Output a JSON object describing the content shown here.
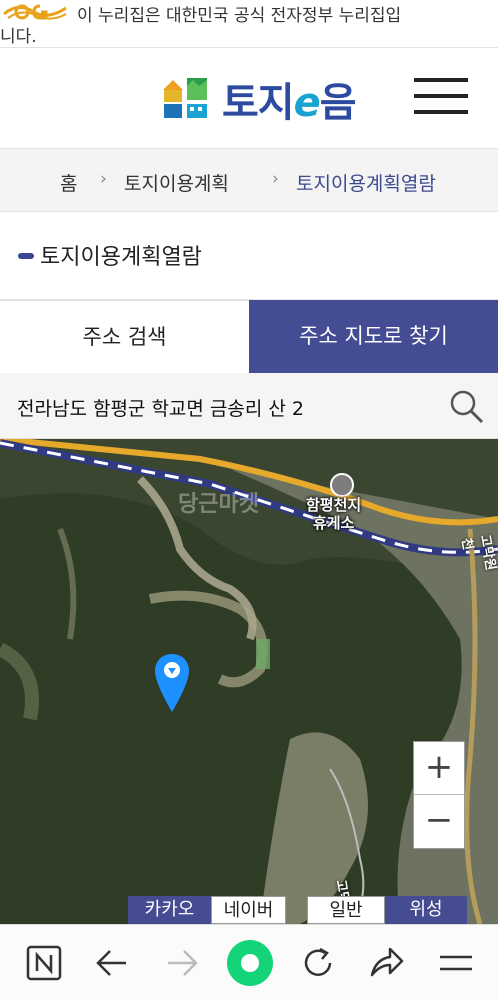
{
  "gov_banner": {
    "text_line1": "이 누리집은 대한민국 공식 전자정부 누리집입",
    "text_line2": "니다."
  },
  "header": {
    "logo_text_main": "토지",
    "logo_text_e": "e",
    "logo_text_end": "음"
  },
  "breadcrumb": {
    "home": "홈",
    "level1": "토지이용계획",
    "current": "토지이용계획열람",
    "separator": "›"
  },
  "page_title": "토지이용계획열람",
  "tabs": [
    {
      "label": "주소 검색",
      "active": false
    },
    {
      "label": "주소 지도로 찾기",
      "active": true
    }
  ],
  "address": {
    "value": "전라남도 함평군 학교면 금송리 산 2"
  },
  "map": {
    "poi_label_line1": "함평천지",
    "poi_label_line2": "휴게소",
    "road_label": "고막원천",
    "road_label2": "고막",
    "watermark": "당근마켓",
    "zoom_in": "+",
    "zoom_out": "−",
    "map_types": {
      "kakao": "카카오",
      "naver": "네이버",
      "normal": "일반",
      "satellite": "위성"
    }
  },
  "colors": {
    "accent": "#444c94",
    "breadcrumb_current": "#3d4a8f",
    "marker": "#1e90ff"
  },
  "browser_bar": {
    "icons": [
      "naver-n-icon",
      "back-arrow-icon",
      "forward-arrow-icon",
      "home-dot-icon",
      "reload-icon",
      "share-icon",
      "menu-icon"
    ]
  }
}
